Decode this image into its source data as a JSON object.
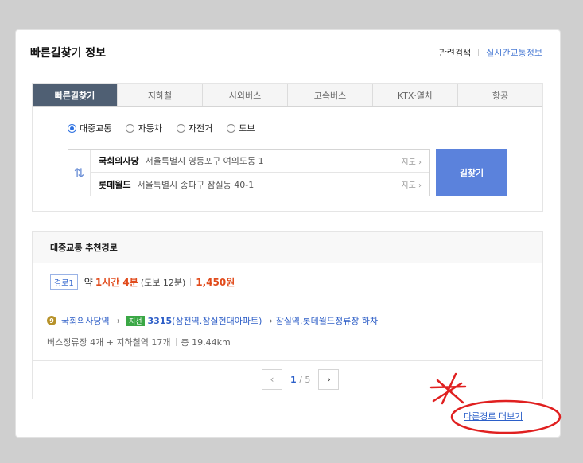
{
  "card": {
    "title": "빠른길찾기 정보",
    "link_related": "관련검색",
    "link_traffic": "실시간교통정보"
  },
  "tabs": [
    {
      "label": "빠른길찾기",
      "active": true
    },
    {
      "label": "지하철"
    },
    {
      "label": "시외버스"
    },
    {
      "label": "고속버스"
    },
    {
      "label": "KTX·열차"
    },
    {
      "label": "항공"
    }
  ],
  "modes": [
    {
      "label": "대중교통",
      "checked": true
    },
    {
      "label": "자동차"
    },
    {
      "label": "자전거"
    },
    {
      "label": "도보"
    }
  ],
  "route": {
    "swap_icon": "⇅",
    "origin": {
      "name": "국회의사당",
      "address": "서울특별시 영등포구 여의도동 1",
      "map_label": "지도 ›"
    },
    "destination": {
      "name": "롯데월드",
      "address": "서울특별시 송파구 잠실동 40-1",
      "map_label": "지도 ›"
    },
    "find_button": "길찾기"
  },
  "results": {
    "heading": "대중교통 추천경로",
    "badge": "경로1",
    "about": "약",
    "time": "1시간 4분",
    "walk": "(도보 12분)",
    "fare": "1,450원",
    "line_number_icon": "9",
    "start_stop": "국회의사당역",
    "bus_tag": "지선",
    "bus_no": "3315",
    "bus_via": "(삼전역.잠실현대아파트)",
    "end_stop": "잠실역.롯데월드정류장 하차",
    "arrow": "→",
    "stats_stops": "버스정류장 4개 + 지하철역 17개",
    "stats_total": "총 19.44km",
    "pager": {
      "prev": "‹",
      "current": "1",
      "separator": "/",
      "total": "5",
      "next": "›"
    }
  },
  "more_link": "다른경로 더보기",
  "colors": {
    "annotation": "#e02020",
    "accent": "#5b82dc",
    "highlight": "#e14b1c"
  }
}
